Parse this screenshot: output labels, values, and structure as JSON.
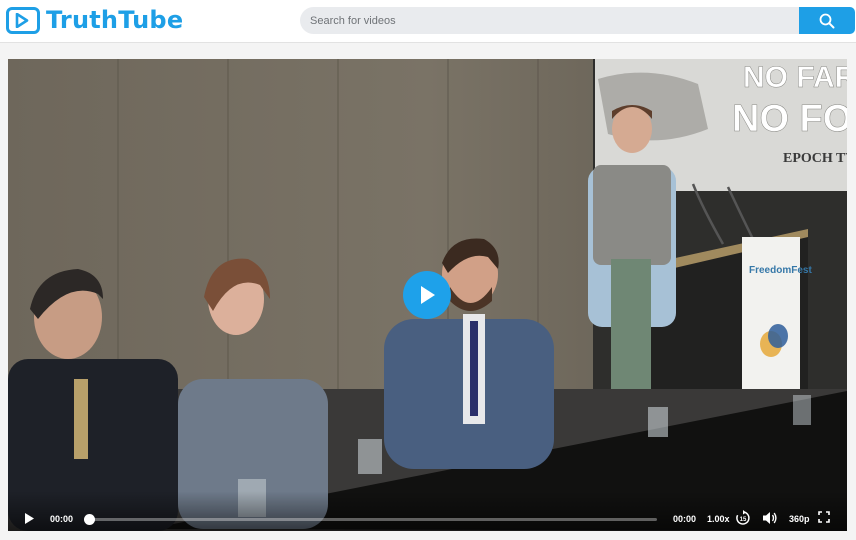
{
  "brand": {
    "name": "TruthTube",
    "accent": "#1e9fe6",
    "logo_icon": "play-icon"
  },
  "search": {
    "placeholder": "Search for videos",
    "icon": "search-icon"
  },
  "player": {
    "scene": {
      "screen_text_line1": "NO FARM",
      "screen_text_line2": "NO FOO",
      "screen_brand": "EPOCH TV",
      "banner_brand": "FreedomFest"
    },
    "current_time": "00:00",
    "duration": "00:00",
    "playback_speed": "1.00x",
    "skip_seconds": "15",
    "quality": "360p",
    "progress_fraction": 0
  }
}
